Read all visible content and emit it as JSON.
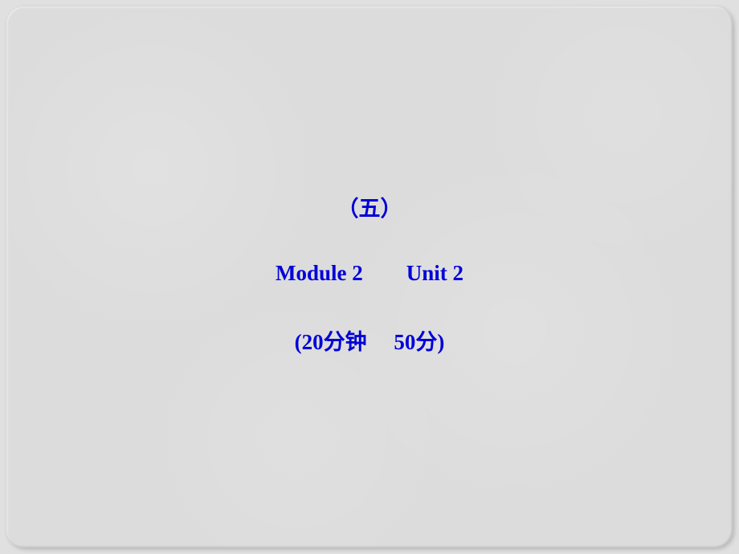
{
  "slide": {
    "section_number": "（五）",
    "module_label": "Module 2",
    "unit_label": "Unit 2",
    "duration_open": "(20",
    "duration_unit": "分钟",
    "score_value": "50",
    "score_unit": "分",
    "close_paren": ")"
  }
}
